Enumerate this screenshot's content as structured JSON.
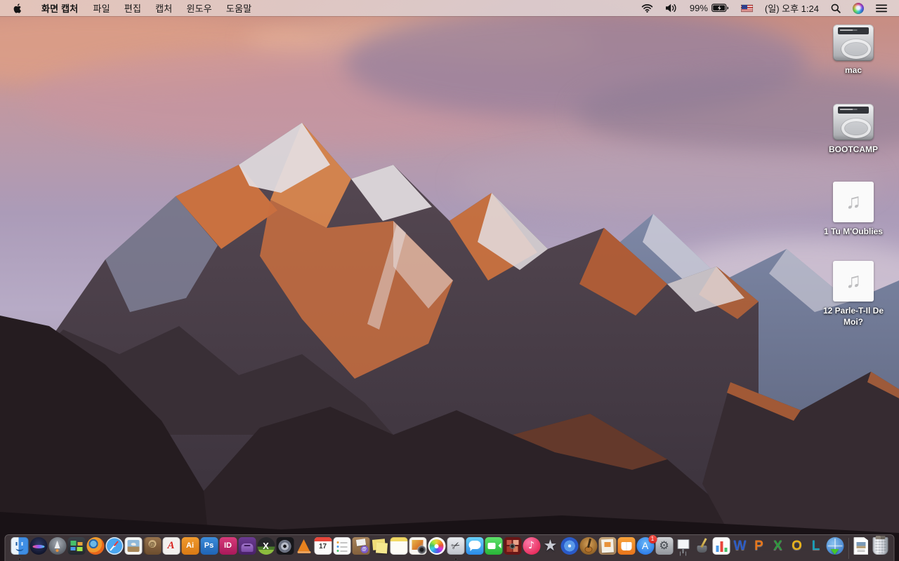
{
  "menu_bar": {
    "app_menus": [
      {
        "name": "app-name",
        "label": "화면 캡처"
      },
      {
        "name": "file",
        "label": "파일"
      },
      {
        "name": "edit",
        "label": "편집"
      },
      {
        "name": "capture",
        "label": "캡처"
      },
      {
        "name": "window",
        "label": "윈도우"
      },
      {
        "name": "help",
        "label": "도움말"
      }
    ],
    "status": {
      "battery_percent": "99%",
      "clock": "(일) 오후 1:24"
    },
    "status_icons": [
      "wifi-icon",
      "volume-icon",
      "battery-charging-icon",
      "us-flag-icon",
      "spotlight-search-icon",
      "siri-icon",
      "notification-center-icon"
    ],
    "colors": {
      "bar_tint": "#e2cac2",
      "text": "#151515"
    }
  },
  "desktop": {
    "icons": [
      {
        "name": "mac-drive",
        "label": "mac",
        "type": "drive"
      },
      {
        "name": "bootcamp-drive",
        "label": "BOOTCAMP",
        "type": "drive"
      },
      {
        "name": "audio-1-tu-moublies",
        "label": "1 Tu M'Oublies",
        "type": "audio"
      },
      {
        "name": "audio-12-parle-t-il-de-moi",
        "label": "12 Parle-T-Il De Moi?",
        "type": "audio"
      }
    ]
  },
  "dock": {
    "items": [
      {
        "name": "finder",
        "running": true
      },
      {
        "name": "siri"
      },
      {
        "name": "launchpad"
      },
      {
        "name": "mission-control"
      },
      {
        "name": "firefox"
      },
      {
        "name": "safari"
      },
      {
        "name": "preview"
      },
      {
        "name": "contacts"
      },
      {
        "name": "acrobat-reader"
      },
      {
        "name": "illustrator"
      },
      {
        "name": "photoshop"
      },
      {
        "name": "indesign"
      },
      {
        "name": "toast"
      },
      {
        "name": "xld"
      },
      {
        "name": "dvd-player"
      },
      {
        "name": "vlc"
      },
      {
        "name": "calendar",
        "glyph": "17"
      },
      {
        "name": "reminders"
      },
      {
        "name": "mail-archiver"
      },
      {
        "name": "stickies"
      },
      {
        "name": "notes"
      },
      {
        "name": "iphoto"
      },
      {
        "name": "photos"
      },
      {
        "name": "grab",
        "running": true
      },
      {
        "name": "messages"
      },
      {
        "name": "facetime"
      },
      {
        "name": "photo-booth"
      },
      {
        "name": "itunes"
      },
      {
        "name": "imovie"
      },
      {
        "name": "idvd"
      },
      {
        "name": "garageband"
      },
      {
        "name": "iweb"
      },
      {
        "name": "ibooks"
      },
      {
        "name": "app-store",
        "badge": "1"
      },
      {
        "name": "system-preferences"
      },
      {
        "name": "keynote"
      },
      {
        "name": "pages"
      },
      {
        "name": "numbers"
      },
      {
        "name": "word"
      },
      {
        "name": "powerpoint"
      },
      {
        "name": "excel"
      },
      {
        "name": "outlook"
      },
      {
        "name": "lync"
      },
      {
        "name": "downloads-globe"
      },
      {
        "name": "divider",
        "type": "divider"
      },
      {
        "name": "document-file",
        "type": "file"
      },
      {
        "name": "trash",
        "type": "trash"
      }
    ]
  }
}
